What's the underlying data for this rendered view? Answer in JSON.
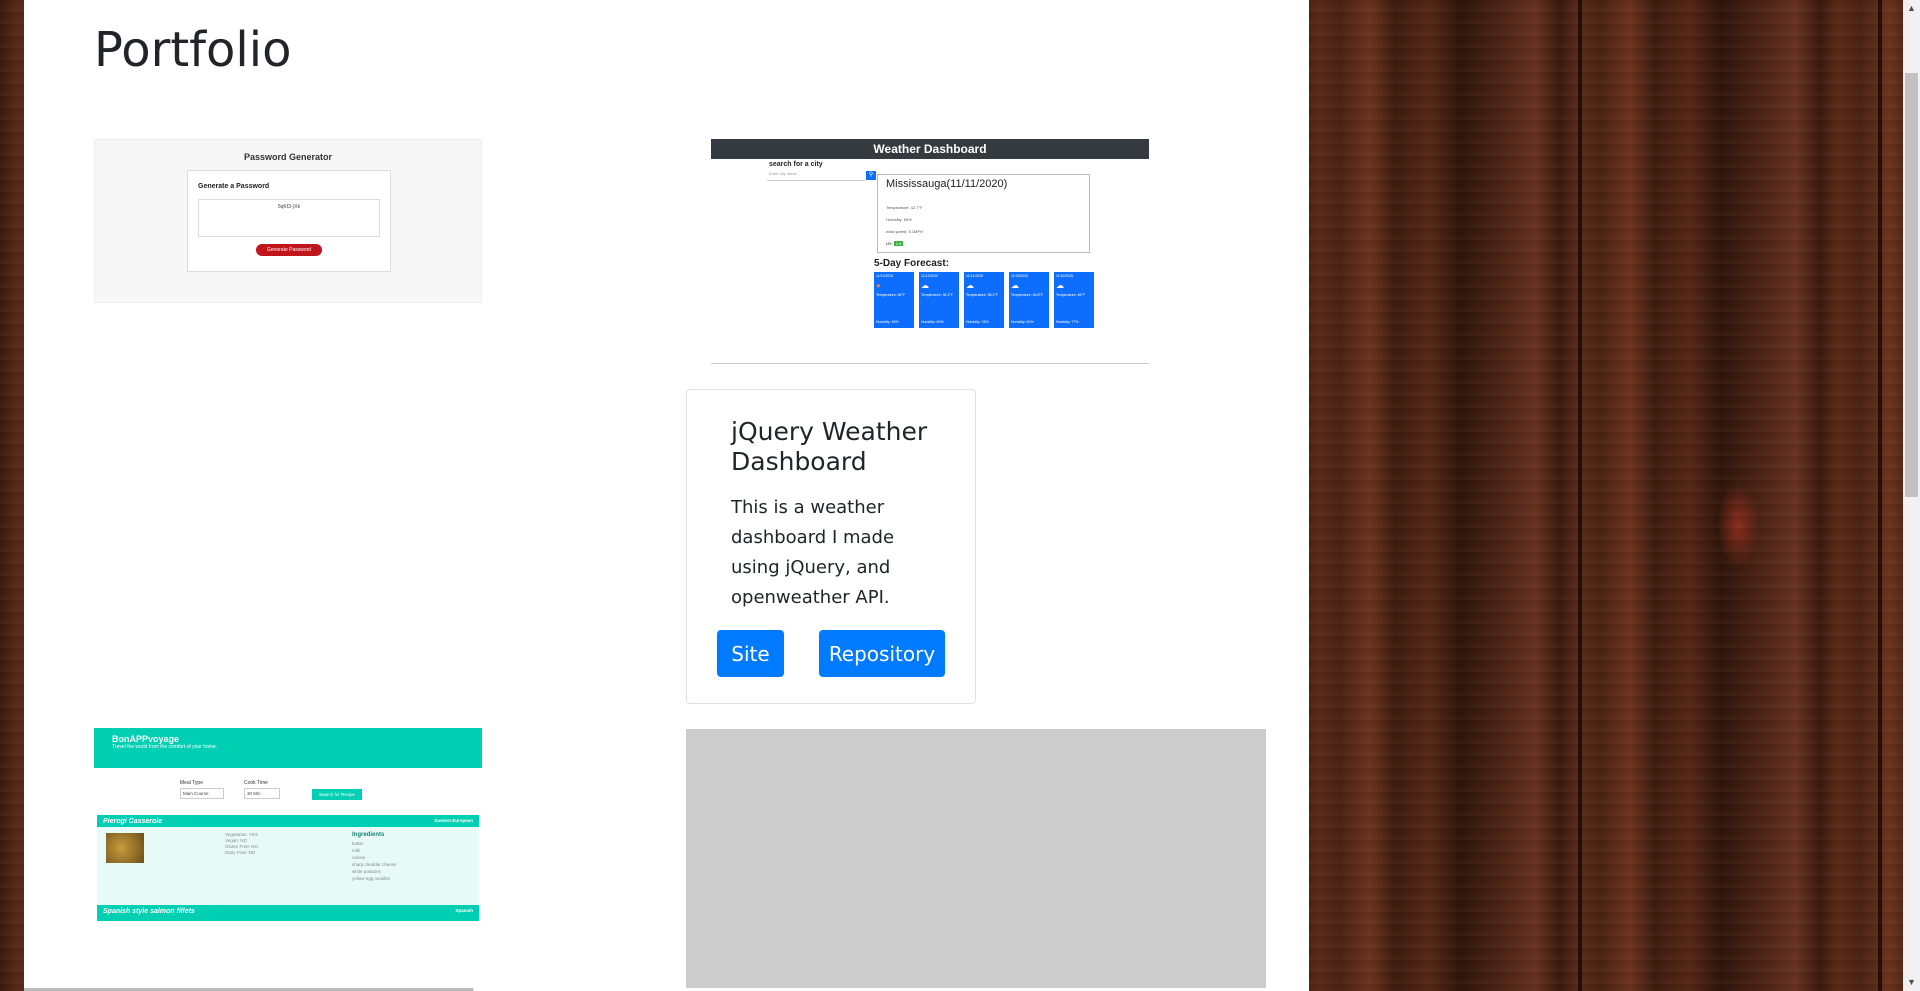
{
  "page": {
    "title": "Portfolio"
  },
  "projects": {
    "password_generator": {
      "title": "Password Generator",
      "card_heading": "Generate a Password",
      "box_text": "5qKf3-)Xk",
      "button": "Generate Password"
    },
    "weather_dashboard": {
      "header": "Weather Dashboard",
      "search_label": "search for a city",
      "search_placeholder": "Enter city name",
      "search_icon": "magnifier-icon",
      "city": "Mississauga(11/11/2020)",
      "temperature": "Temperature: 42.7°F",
      "humidity": "Humidity: 65%",
      "wind": "wind speed: 5.1MPH",
      "uv_label": "UV:",
      "uv_value": "1.6",
      "forecast_heading": "5-Day Forecast:",
      "forecast": [
        {
          "date": "11/12/2020",
          "icon": "sun-icon",
          "temp": "Temperature: 46°F",
          "humidity": "Humidity: 48%"
        },
        {
          "date": "11/13/2020",
          "icon": "cloud-icon",
          "temp": "Temperature: 35.2°F",
          "humidity": "Humidity: 60%"
        },
        {
          "date": "11/14/2020",
          "icon": "cloud-icon",
          "temp": "Temperature: 38.2°F",
          "humidity": "Humidity: 76%"
        },
        {
          "date": "11/15/2020",
          "icon": "cloud-icon",
          "temp": "Temperature: 46.8°F",
          "humidity": "Humidity: 60%"
        },
        {
          "date": "11/16/2020",
          "icon": "cloud-icon",
          "temp": "Temperature: 46°F",
          "humidity": "Humidity: 77%"
        }
      ]
    },
    "card": {
      "title": "jQuery Weather Dashboard",
      "description": "This is a weather dashboard I made using jQuery, and openweather API.",
      "site_button": "Site",
      "repo_button": "Repository"
    },
    "bonappvoyage": {
      "title": "BonAPPvoyage",
      "subtitle": "Travel the world from the comfort of your home.",
      "meal_type_label": "Meal Type",
      "meal_type_value": "Main Course",
      "cook_time_label": "Cook Time",
      "cook_time_value": "30 Min",
      "search_button": "Search for Recipe",
      "recipe1": {
        "name": "Pierogi Casserole",
        "cuisine": "Eastern European",
        "diet_lines": [
          "Vegetarian: YES",
          "Vegan: NO",
          "Gluten Free: NO",
          "Dairy Free: NO"
        ],
        "ingredients_heading": "Ingredients",
        "ingredients": [
          "butter",
          "milk",
          "onions",
          "sharp cheddar cheese",
          "white potatoes",
          "yellow egg noodles"
        ]
      },
      "recipe2": {
        "name": "Spanish style salmon fillets",
        "cuisine": "Spanish"
      }
    }
  },
  "scrollbar": {
    "up_icon": "▲",
    "down_icon": "▼"
  }
}
